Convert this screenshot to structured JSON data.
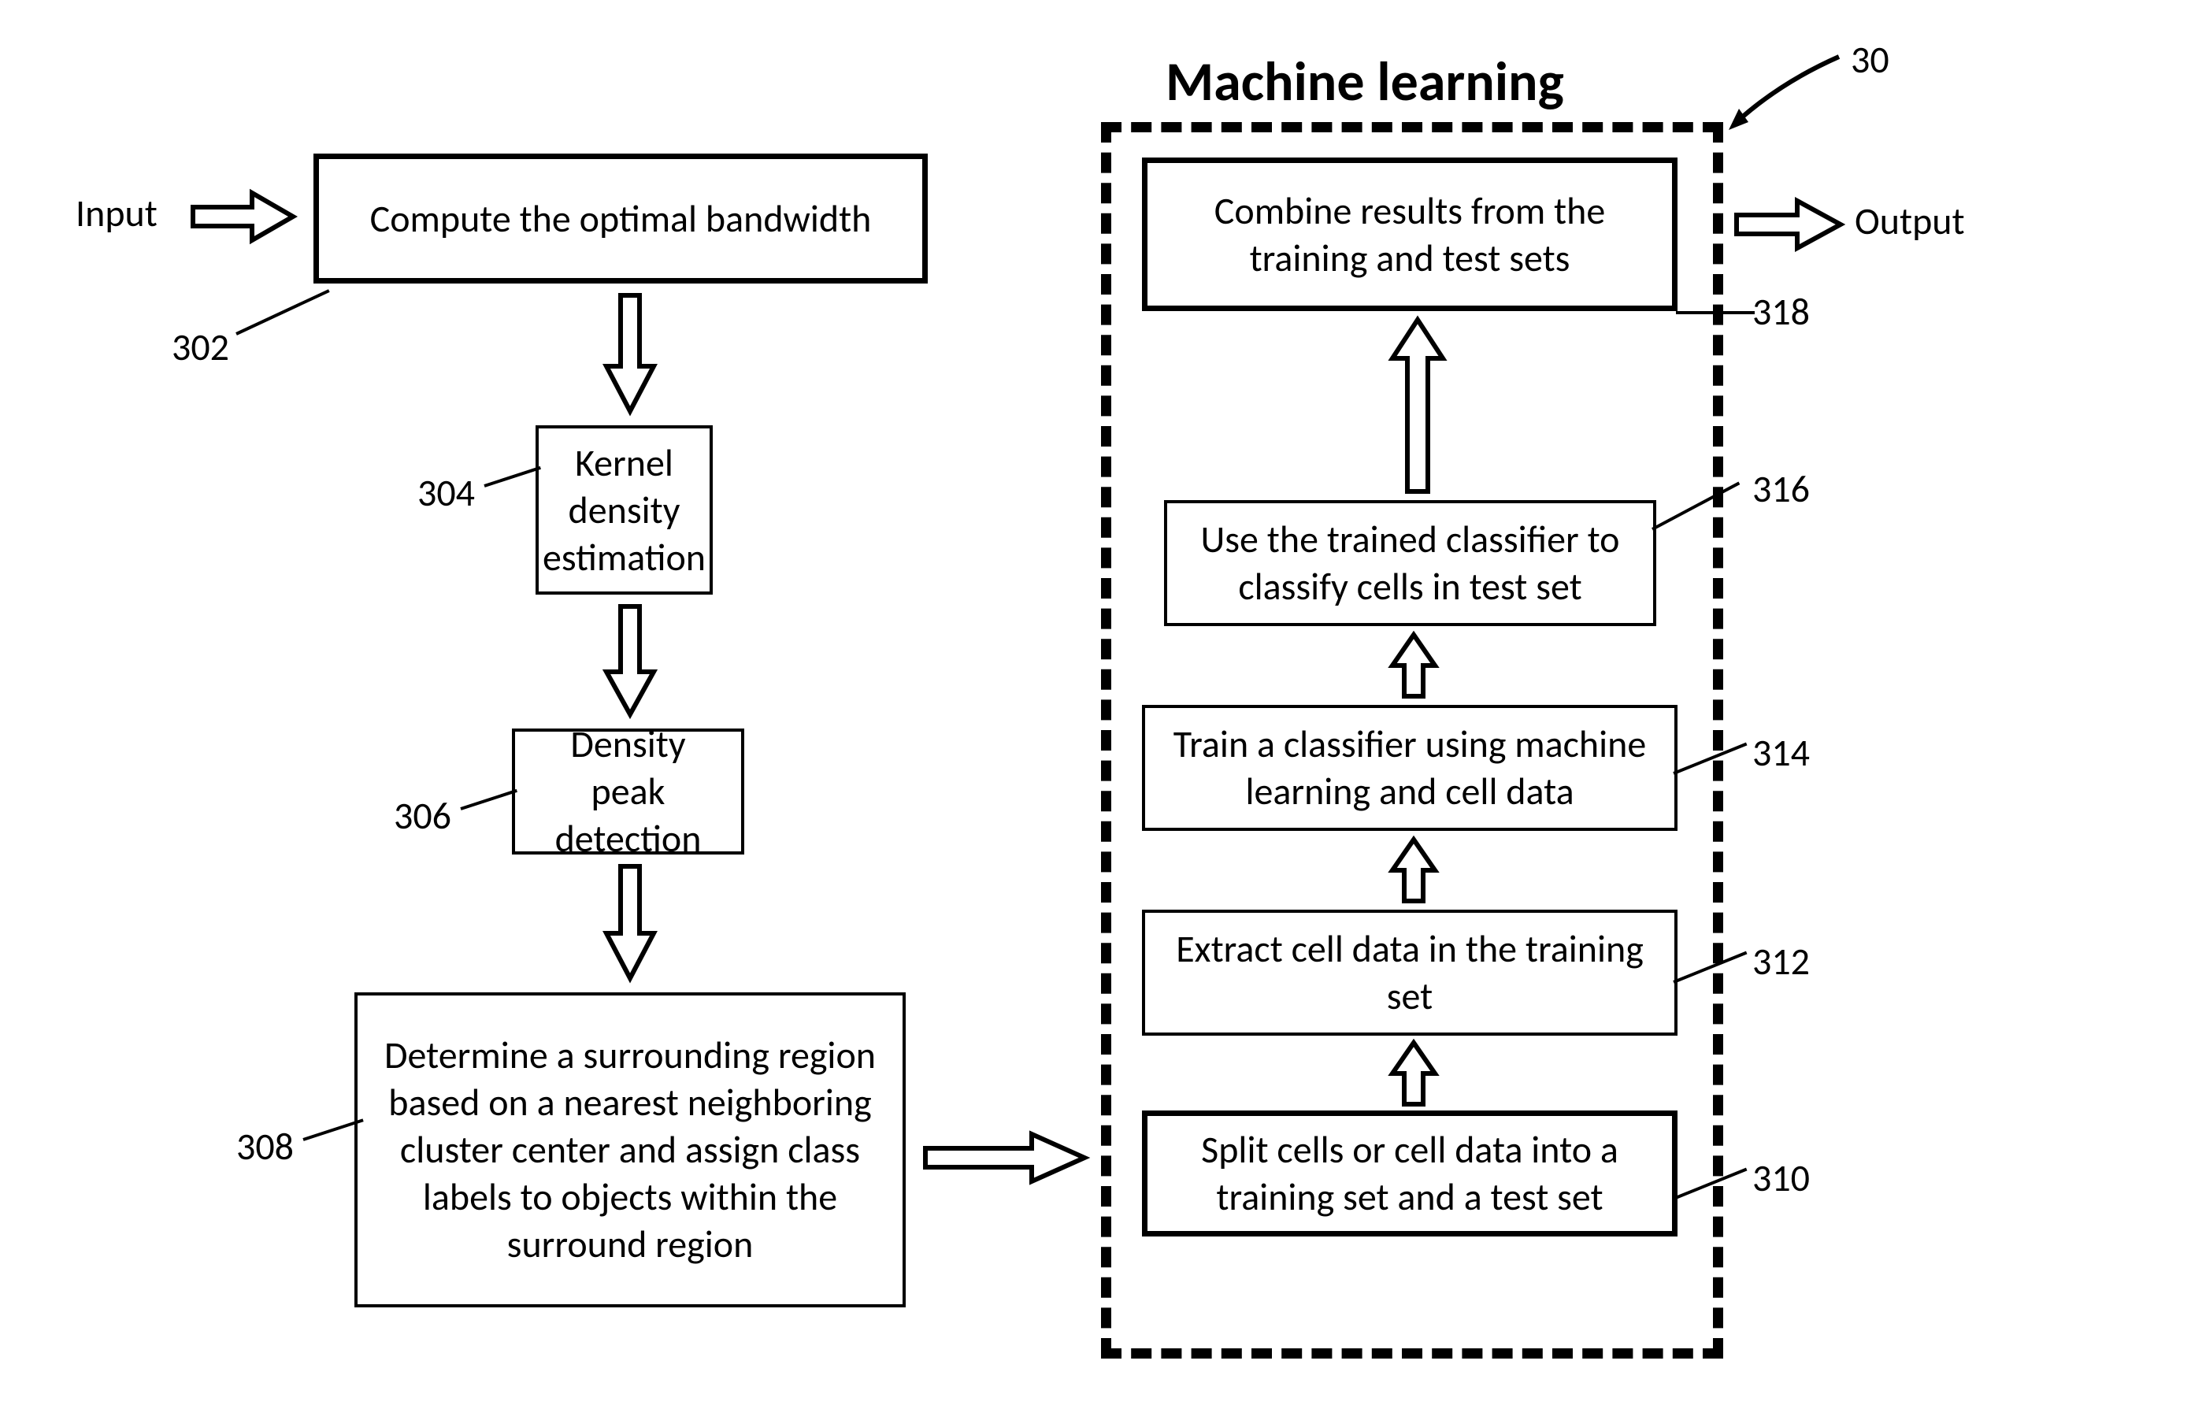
{
  "labels": {
    "input": "Input",
    "output": "Output",
    "ml_title": "Machine learning",
    "n302": "302",
    "n304": "304",
    "n306": "306",
    "n308": "308",
    "n310": "310",
    "n312": "312",
    "n314": "314",
    "n316": "316",
    "n318": "318",
    "n30": "30"
  },
  "boxes": {
    "b302": "Compute the optimal bandwidth",
    "b304": "Kernel density estimation",
    "b306": "Density peak detection",
    "b308": "Determine a surrounding region based on a nearest neighboring cluster center and assign class labels to objects within the surround region",
    "b310": "Split cells or cell data into a training set and a test set",
    "b312": "Extract cell data in the training set",
    "b314": "Train a classifier using machine learning and cell data",
    "b316": "Use  the trained classifier to classify cells in test set",
    "b318": "Combine results from the training and test sets"
  }
}
